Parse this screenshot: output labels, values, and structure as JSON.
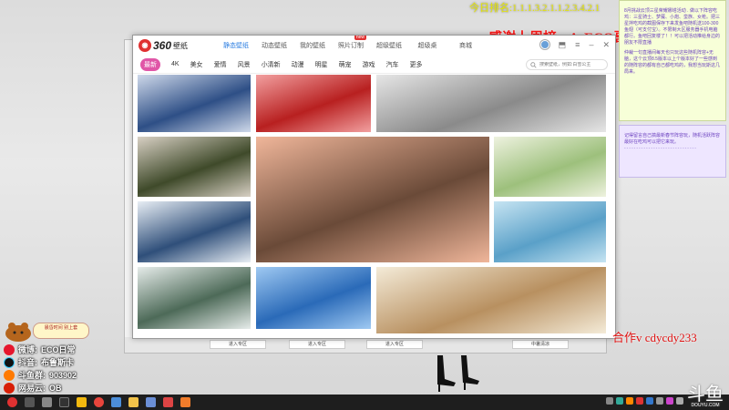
{
  "overlay": {
    "ticker": "今日排名:1.1.1.3.2.1.1.2.3.4.2.1",
    "banner": "感谢上周榜一：ECO哥",
    "contact": "合作v cdycdy233"
  },
  "app": {
    "logo_num": "360",
    "logo_text": "壁纸",
    "nav": [
      {
        "label": "静态壁纸",
        "active": true
      },
      {
        "label": "动态壁纸"
      },
      {
        "label": "我的壁纸"
      },
      {
        "label": "照片订制",
        "badge": "new"
      },
      {
        "label": "超级壁纸"
      },
      {
        "label": "超级桌"
      },
      {
        "label": "商城"
      }
    ],
    "categories": [
      "最新",
      "4K",
      "美女",
      "爱情",
      "风景",
      "小清新",
      "动漫",
      "明星",
      "萌宠",
      "游戏",
      "汽车",
      "更多"
    ],
    "search_placeholder": "搜索壁纸，例如:白雪公主",
    "tiles": [
      {
        "name": "anime-girls-group",
        "c1": "#2e4f86",
        "c2": "#cfd9ea"
      },
      {
        "name": "red-fantasy",
        "c1": "#b82020",
        "c2": "#f2a0a0"
      },
      {
        "name": "sports-car-sketch",
        "c1": "#8a8a8a",
        "c2": "#e6e6e6"
      },
      {
        "name": "girl-portrait-flowers",
        "c1": "#3f4a2a",
        "c2": "#d8d0c4"
      },
      {
        "name": "forest-lake-reflection",
        "c1": "#6a4a38",
        "c2": "#f0b69a"
      },
      {
        "name": "anime-girls-field",
        "c1": "#9dc07c",
        "c2": "#eef2df"
      },
      {
        "name": "cherry-blossom-branches",
        "c1": "#2f4f7a",
        "c2": "#e8eef4"
      },
      {
        "name": "anime-cat-girl",
        "c1": "#5aa0c8",
        "c2": "#c6e4f2"
      },
      {
        "name": "mountain-lake-boat",
        "c1": "#4d6a58",
        "c2": "#e6ecea"
      },
      {
        "name": "anime-window-sky",
        "c1": "#2a6ab8",
        "c2": "#9fc9f2"
      },
      {
        "name": "flowers-in-bowl",
        "c1": "#b89060",
        "c2": "#f4ebd8"
      }
    ]
  },
  "background_window": {
    "buttons": [
      "进入专区",
      "进入专区",
      "进入专区",
      "中暑清凉"
    ]
  },
  "notes": {
    "text1": "8月挑战云顶三星荣耀娜塔活动 . 做以下阵容吃鸡：三星骑士、梦魇、小炮、蛮族、女枪。把三星拌吃鸡的截图保存下来发鱼吧随机送100-300鱼翅（可支付宝）。不限制大区服务器手机电脑都行。鱼吧回复楼了！！可以把活动推给身边的朋友不限直播",
    "text2": "仲裁一句直播间每天也只玩这些随机阵容+无脑，这个云顶8.5版本以上个版本好了一些感到的随阵容的都有自己都吃鸡的，我想当玩斯这几局来。",
    "text3": "记得留言自己搞最新春节阵容玩，随机活跃阵容最好在吃鸡可以把它来玩。",
    "dashes": "------------------------------"
  },
  "streamer": {
    "pill": "晨昏时间 别上套",
    "socials": [
      {
        "label": "微博:",
        "value": "ECO日常",
        "color": "#e6162d"
      },
      {
        "label": "抖音:",
        "value": "布鲁斯卡",
        "color": "#111111"
      },
      {
        "label": "斗鱼群:",
        "value": "903902",
        "color": "#ff7a00"
      },
      {
        "label": "网易云:",
        "value": "OB",
        "color": "#d81e06"
      }
    ]
  },
  "watermark": {
    "logo": "斗鱼",
    "url": "DOUYU.COM"
  }
}
